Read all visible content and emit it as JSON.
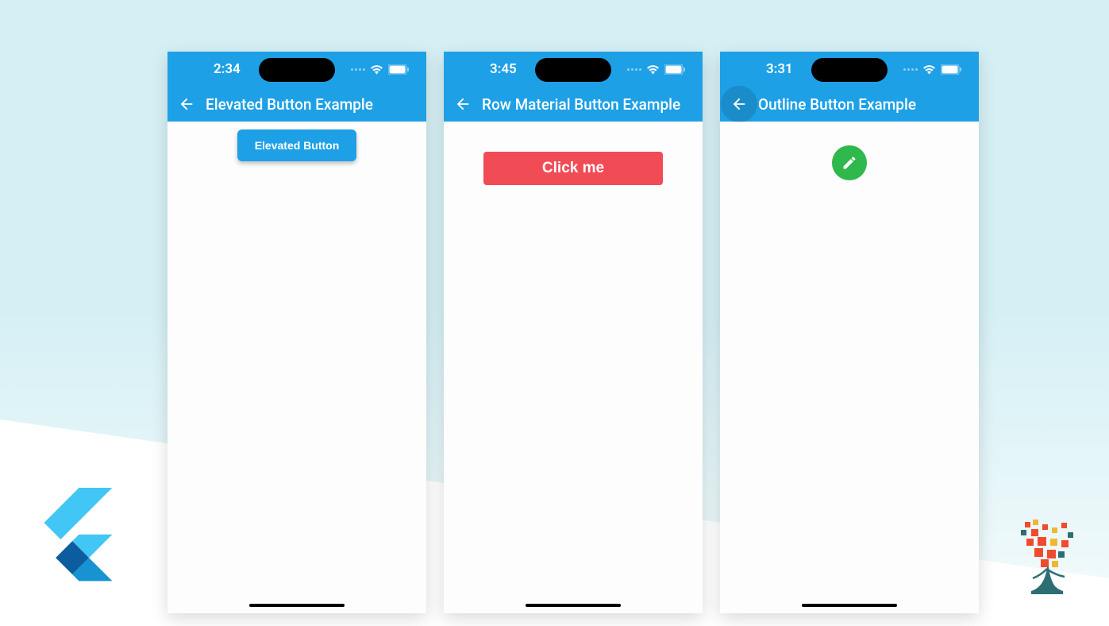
{
  "phones": [
    {
      "time": "2:34",
      "title": "Elevated Button Example",
      "button_label": "Elevated Button"
    },
    {
      "time": "3:45",
      "title": "Row Material Button Example",
      "button_label": "Click me"
    },
    {
      "time": "3:31",
      "title": "Outline Button Example",
      "fab_icon": "edit-icon"
    }
  ],
  "colors": {
    "app_bar": "#1ea0e6",
    "elevated_button": "#1ea0e6",
    "material_button": "#f14b56",
    "fab": "#2fb84b"
  }
}
